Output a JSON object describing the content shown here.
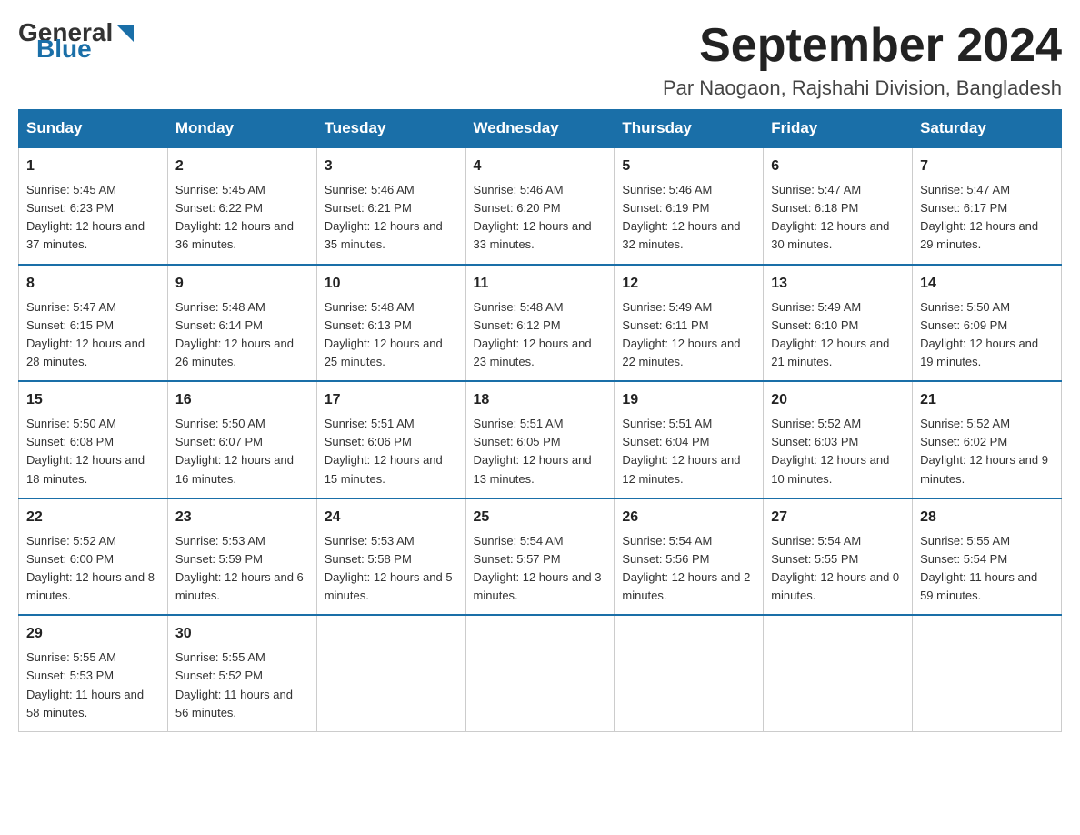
{
  "header": {
    "logo_general": "General",
    "logo_blue": "Blue",
    "month_title": "September 2024",
    "location": "Par Naogaon, Rajshahi Division, Bangladesh"
  },
  "days_of_week": [
    "Sunday",
    "Monday",
    "Tuesday",
    "Wednesday",
    "Thursday",
    "Friday",
    "Saturday"
  ],
  "weeks": [
    [
      {
        "day": "1",
        "sunrise": "5:45 AM",
        "sunset": "6:23 PM",
        "daylight": "12 hours and 37 minutes."
      },
      {
        "day": "2",
        "sunrise": "5:45 AM",
        "sunset": "6:22 PM",
        "daylight": "12 hours and 36 minutes."
      },
      {
        "day": "3",
        "sunrise": "5:46 AM",
        "sunset": "6:21 PM",
        "daylight": "12 hours and 35 minutes."
      },
      {
        "day": "4",
        "sunrise": "5:46 AM",
        "sunset": "6:20 PM",
        "daylight": "12 hours and 33 minutes."
      },
      {
        "day": "5",
        "sunrise": "5:46 AM",
        "sunset": "6:19 PM",
        "daylight": "12 hours and 32 minutes."
      },
      {
        "day": "6",
        "sunrise": "5:47 AM",
        "sunset": "6:18 PM",
        "daylight": "12 hours and 30 minutes."
      },
      {
        "day": "7",
        "sunrise": "5:47 AM",
        "sunset": "6:17 PM",
        "daylight": "12 hours and 29 minutes."
      }
    ],
    [
      {
        "day": "8",
        "sunrise": "5:47 AM",
        "sunset": "6:15 PM",
        "daylight": "12 hours and 28 minutes."
      },
      {
        "day": "9",
        "sunrise": "5:48 AM",
        "sunset": "6:14 PM",
        "daylight": "12 hours and 26 minutes."
      },
      {
        "day": "10",
        "sunrise": "5:48 AM",
        "sunset": "6:13 PM",
        "daylight": "12 hours and 25 minutes."
      },
      {
        "day": "11",
        "sunrise": "5:48 AM",
        "sunset": "6:12 PM",
        "daylight": "12 hours and 23 minutes."
      },
      {
        "day": "12",
        "sunrise": "5:49 AM",
        "sunset": "6:11 PM",
        "daylight": "12 hours and 22 minutes."
      },
      {
        "day": "13",
        "sunrise": "5:49 AM",
        "sunset": "6:10 PM",
        "daylight": "12 hours and 21 minutes."
      },
      {
        "day": "14",
        "sunrise": "5:50 AM",
        "sunset": "6:09 PM",
        "daylight": "12 hours and 19 minutes."
      }
    ],
    [
      {
        "day": "15",
        "sunrise": "5:50 AM",
        "sunset": "6:08 PM",
        "daylight": "12 hours and 18 minutes."
      },
      {
        "day": "16",
        "sunrise": "5:50 AM",
        "sunset": "6:07 PM",
        "daylight": "12 hours and 16 minutes."
      },
      {
        "day": "17",
        "sunrise": "5:51 AM",
        "sunset": "6:06 PM",
        "daylight": "12 hours and 15 minutes."
      },
      {
        "day": "18",
        "sunrise": "5:51 AM",
        "sunset": "6:05 PM",
        "daylight": "12 hours and 13 minutes."
      },
      {
        "day": "19",
        "sunrise": "5:51 AM",
        "sunset": "6:04 PM",
        "daylight": "12 hours and 12 minutes."
      },
      {
        "day": "20",
        "sunrise": "5:52 AM",
        "sunset": "6:03 PM",
        "daylight": "12 hours and 10 minutes."
      },
      {
        "day": "21",
        "sunrise": "5:52 AM",
        "sunset": "6:02 PM",
        "daylight": "12 hours and 9 minutes."
      }
    ],
    [
      {
        "day": "22",
        "sunrise": "5:52 AM",
        "sunset": "6:00 PM",
        "daylight": "12 hours and 8 minutes."
      },
      {
        "day": "23",
        "sunrise": "5:53 AM",
        "sunset": "5:59 PM",
        "daylight": "12 hours and 6 minutes."
      },
      {
        "day": "24",
        "sunrise": "5:53 AM",
        "sunset": "5:58 PM",
        "daylight": "12 hours and 5 minutes."
      },
      {
        "day": "25",
        "sunrise": "5:54 AM",
        "sunset": "5:57 PM",
        "daylight": "12 hours and 3 minutes."
      },
      {
        "day": "26",
        "sunrise": "5:54 AM",
        "sunset": "5:56 PM",
        "daylight": "12 hours and 2 minutes."
      },
      {
        "day": "27",
        "sunrise": "5:54 AM",
        "sunset": "5:55 PM",
        "daylight": "12 hours and 0 minutes."
      },
      {
        "day": "28",
        "sunrise": "5:55 AM",
        "sunset": "5:54 PM",
        "daylight": "11 hours and 59 minutes."
      }
    ],
    [
      {
        "day": "29",
        "sunrise": "5:55 AM",
        "sunset": "5:53 PM",
        "daylight": "11 hours and 58 minutes."
      },
      {
        "day": "30",
        "sunrise": "5:55 AM",
        "sunset": "5:52 PM",
        "daylight": "11 hours and 56 minutes."
      },
      null,
      null,
      null,
      null,
      null
    ]
  ],
  "labels": {
    "sunrise": "Sunrise:",
    "sunset": "Sunset:",
    "daylight": "Daylight:"
  }
}
